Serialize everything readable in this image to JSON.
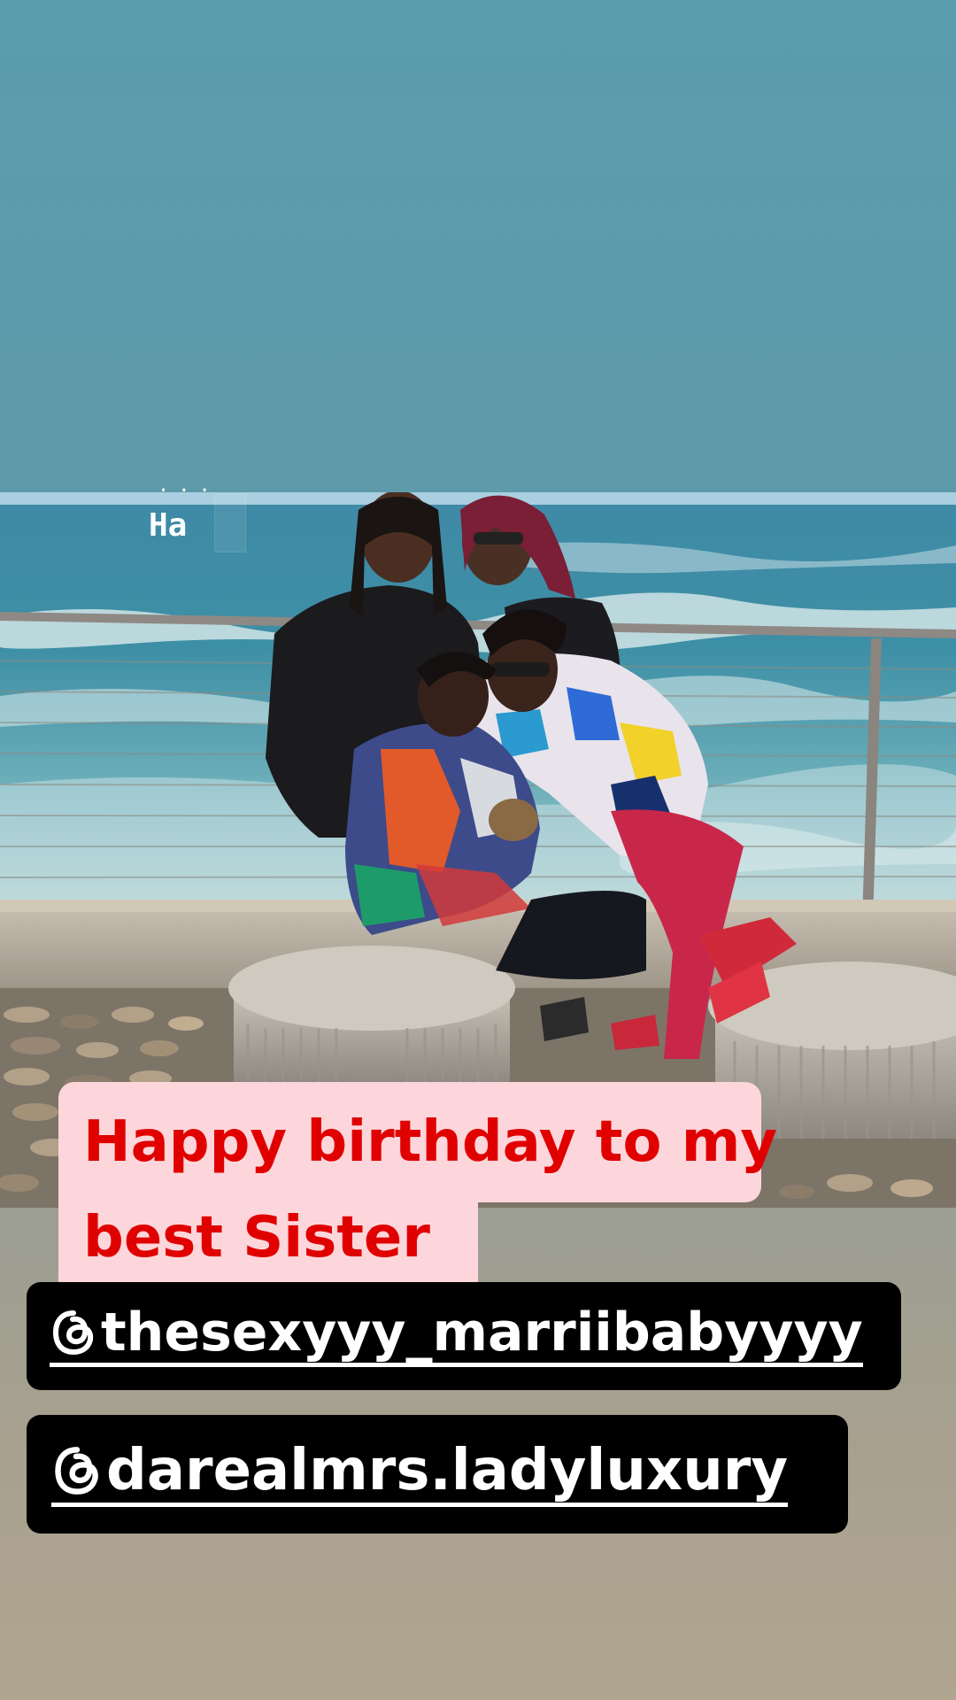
{
  "story": {
    "overlay_text": {
      "dots": "...",
      "text": "Ha"
    },
    "caption": {
      "line1": "Happy birthday to my",
      "line2": "best Sister",
      "text_color": "#e00000",
      "background_color": "#fcd6da"
    },
    "mentions": [
      {
        "handle": "thesexyyy_marriibabyyyy",
        "icon": "threads-icon"
      },
      {
        "handle": "darealmrs.ladyluxury",
        "icon": "threads-icon"
      }
    ]
  }
}
